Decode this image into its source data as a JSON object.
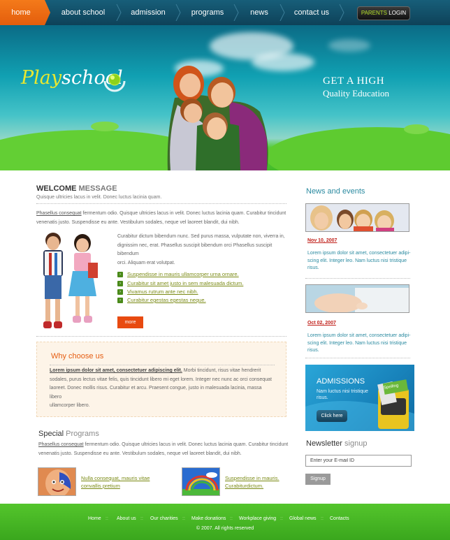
{
  "nav": {
    "items": [
      "home",
      "about school",
      "admission",
      "programs",
      "news",
      "contact us"
    ],
    "parents_prefix": "PARENTS",
    "parents_login": "LOGIN"
  },
  "hero": {
    "logo_part1": "Play",
    "logo_part2": "school",
    "tagline1": "GET A HIGH",
    "tagline2": "Quality Education"
  },
  "welcome": {
    "title_strong": "WELCOME",
    "title_accent": "MESSAGE",
    "subtitle": "Quisque ultricies lacus in velit. Donec luctus lacinia quam.",
    "intro_link": "Phasellus consequat",
    "intro_line1_rest": " fermentum odio. Quisque ultricies lacus in velit. Donec luctus lacinia quam. Curabitur tincidunt",
    "intro_line2": "venenatis justo. Suspendisse eu ante. Vestibulum sodales, neque vel laoreet blandit, dui nibh.",
    "body_line1": "Curabitur dictum bibendum nunc. Sed purus massa, vulputate non, viverra in,",
    "body_line2": "dignissim nec, erat. Phasellus suscipit bibendum orci Phasellus suscipit bibendum",
    "body_line3": "orci. Aliquam erat volutpat.",
    "bullets": [
      "Suspendisse in mauris ullamcorper urna ornare.",
      "Curabitur sit amet justo in sem malesuada dictum.",
      "Vivamus rutrum ante nec nibh.",
      "Curabitur egestas egestas neque."
    ],
    "more": "more"
  },
  "why": {
    "title": "Why choose us",
    "bold": "Lorem ipsum dolor sit amet, consectetuer adipiscing elit.",
    "line1_rest": " Morbi tincidunt, risus vitae hendrerit",
    "line2": "sodales, purus lectus vitae felis, quis tincidunt libero mi eget lorem. Integer nec nunc ac orci consequat",
    "line3": "laoreet. Donec mollis risus. Curabitur et arcu. Praesent congue, justo in malesuada lacinia, massa libero",
    "line4": "ullamcorper libero."
  },
  "special": {
    "title_strong": "Special",
    "title_accent": "Programs",
    "intro_link": "Phasellus consequat",
    "intro_line1_rest": " fermentum odio. Quisque ultricies lacus in velit. Donec luctus lacinia quam. Curabitur tincidunt",
    "intro_line2": "venenatis justo. Suspendisse eu ante. Vestibulum sodales, neque vel laoreet blandit, dui nibh.",
    "prog1_line1": "Nulla consequat, mauris vitae",
    "prog1_line2": "convallis pretium",
    "prog2_line1": "Suspendisse in mauris.",
    "prog2_line2": "Curabiturdictum."
  },
  "sidebar": {
    "news_title": "News and events",
    "news": [
      {
        "date": "Nov 10, 2007",
        "line1": "Lorem ipsum dolor sit amet, consectetuer adipi-",
        "line2": "scing elit. Integer leo. Nam luctus nisi tristique",
        "line3": "risus."
      },
      {
        "date": "Oct 02, 2007",
        "line1": "Lorem ipsum dolor sit amet, consectetuer adipi-",
        "line2": "scing elit. Integer leo. Nam luctus nisi tristique",
        "line3": "risus."
      }
    ],
    "admissions_title": "ADMISSIONS",
    "admissions_text": "Nam luctus nisi tristique risus.",
    "admissions_btn": "Click here",
    "book_label": "Spelling",
    "newsletter_strong": "Newsletter",
    "newsletter_accent": "signup",
    "email_value": "Enter your E-mail ID",
    "signup": "Signup"
  },
  "footer": {
    "links": [
      "Home",
      "About us",
      "Our charities",
      "Make donations",
      "Workplace giving",
      "Global news",
      "Contacts"
    ],
    "separator": "::",
    "copyright": "© 2007. All rights reserved"
  },
  "colors": {
    "nav_bg": "#0e4259",
    "home_active": "#e8661a",
    "accent_teal": "#2a8aa0",
    "link_olive": "#7a8a14",
    "date_red": "#c0201a",
    "footer_green": "#46b424",
    "orange_btn": "#e84a10"
  }
}
